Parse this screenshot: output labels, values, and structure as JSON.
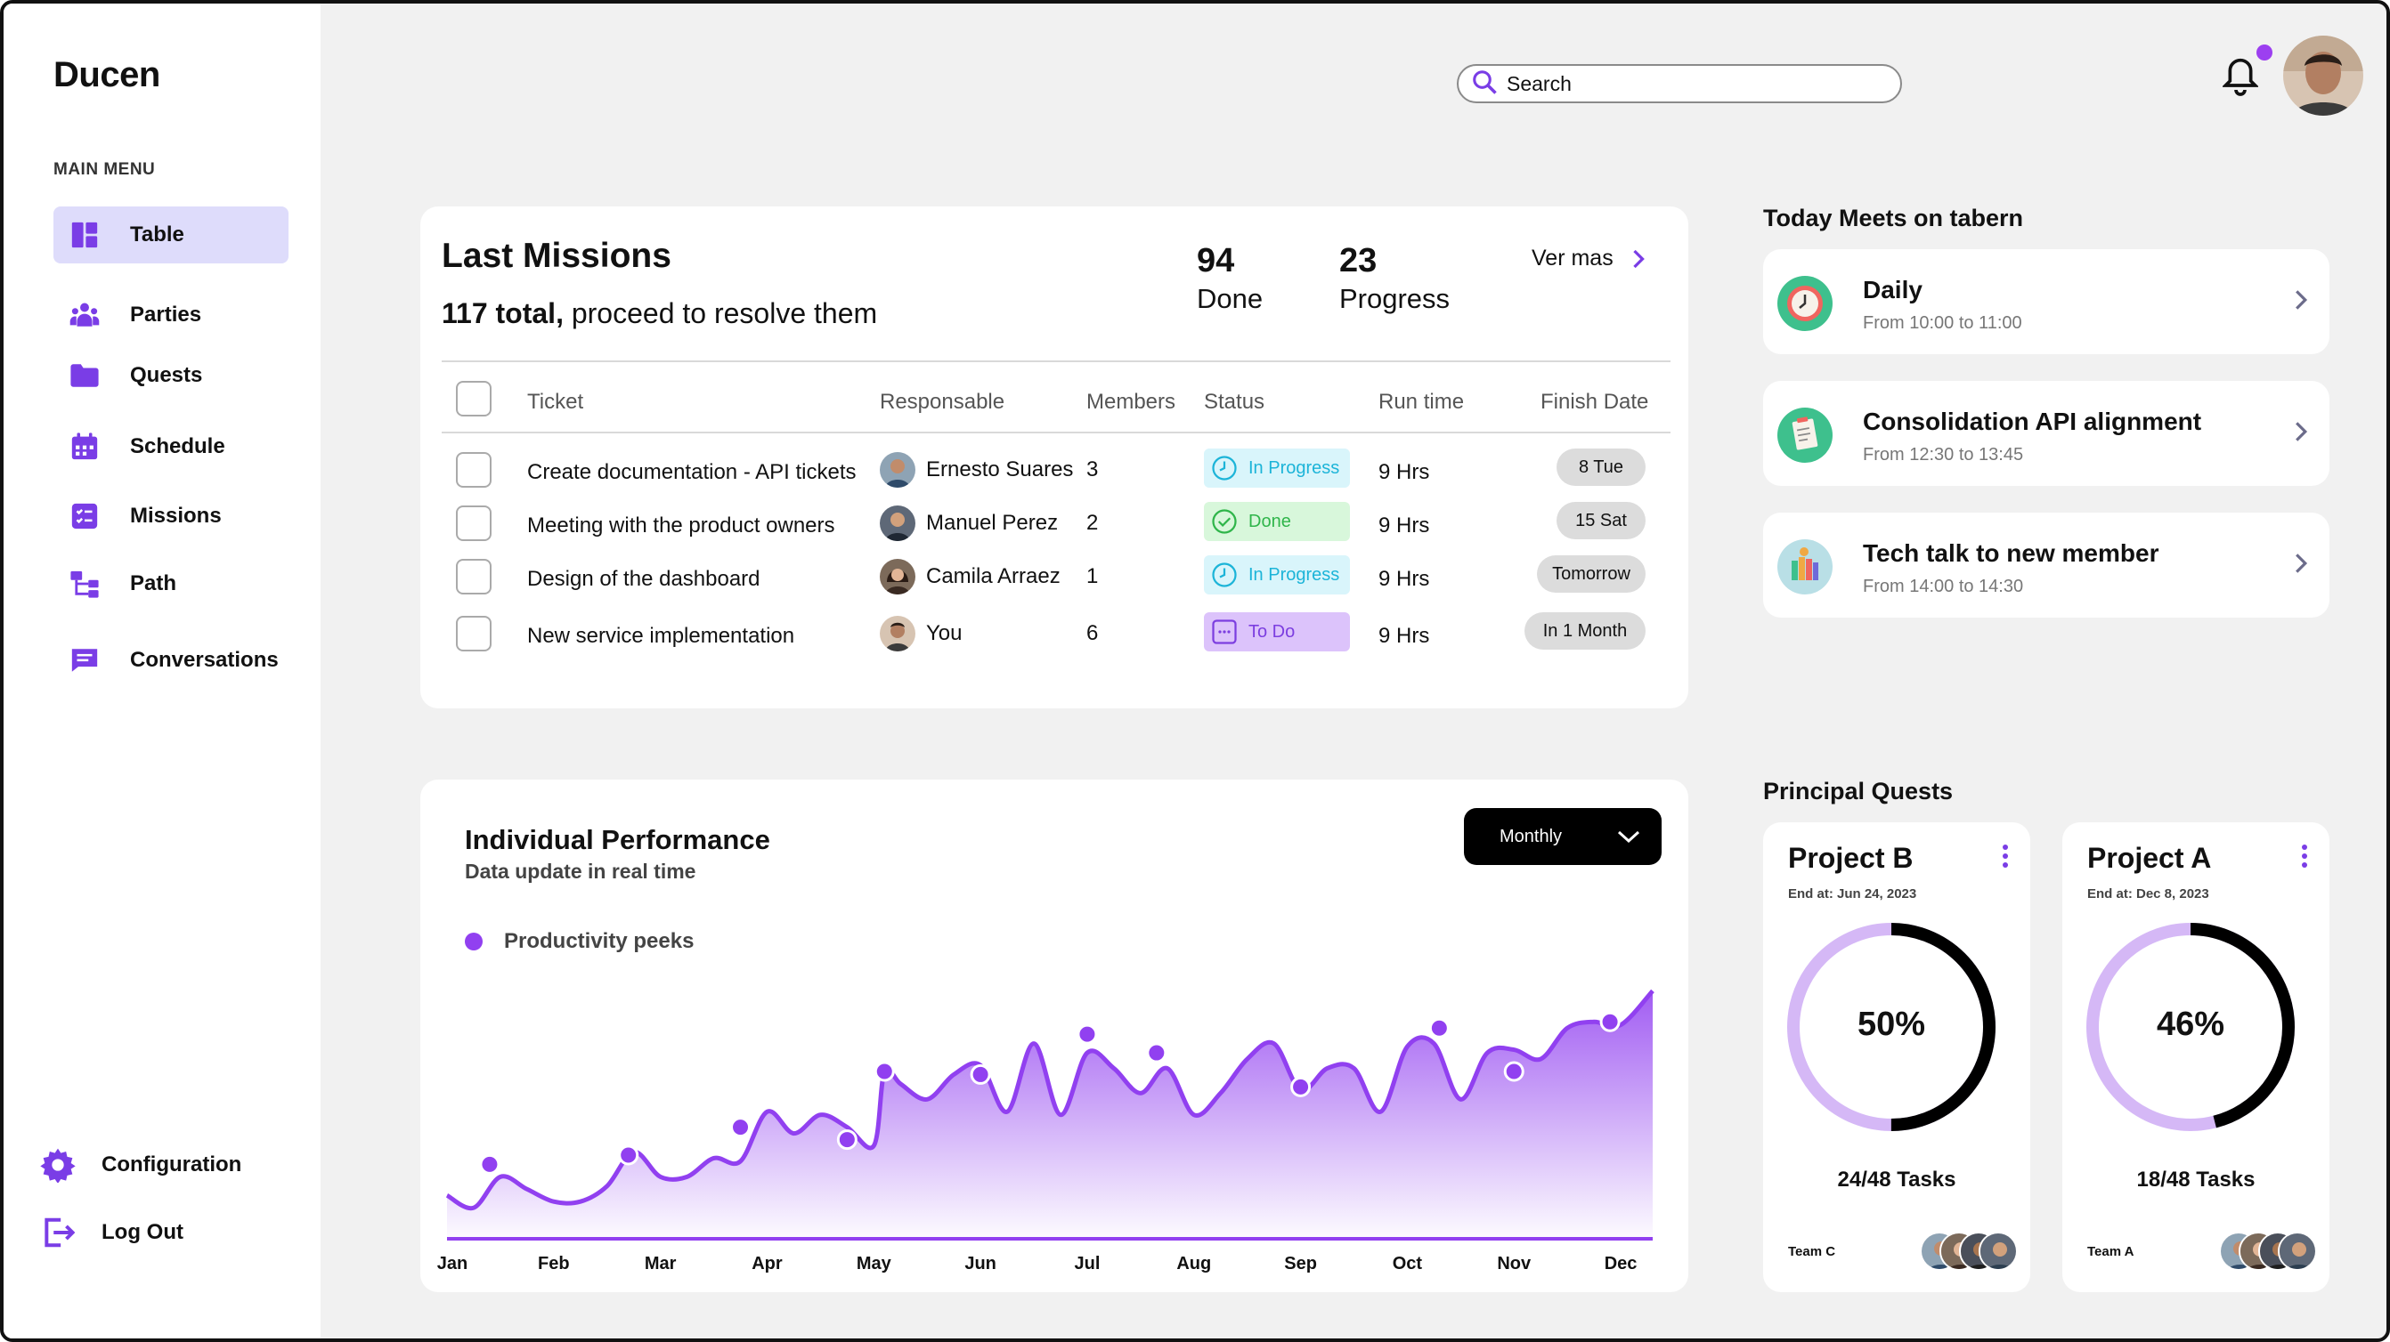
{
  "app": {
    "logo": "Ducen"
  },
  "sidebar": {
    "menu_heading": "MAIN MENU",
    "items": [
      {
        "label": "Table",
        "icon": "dashboard-icon",
        "active": true
      },
      {
        "label": "Parties",
        "icon": "users-icon"
      },
      {
        "label": "Quests",
        "icon": "folder-icon"
      },
      {
        "label": "Schedule",
        "icon": "calendar-icon"
      },
      {
        "label": "Missions",
        "icon": "checklist-icon"
      },
      {
        "label": "Path",
        "icon": "flow-icon"
      },
      {
        "label": "Conversations",
        "icon": "chat-icon"
      }
    ],
    "bottom": [
      {
        "label": "Configuration",
        "icon": "gear-icon"
      },
      {
        "label": "Log Out",
        "icon": "logout-icon"
      }
    ]
  },
  "topbar": {
    "search_placeholder": "Search"
  },
  "missions": {
    "title": "Last Missions",
    "total_bold": "117 total,",
    "total_rest": " proceed to resolve them",
    "done_count": "94",
    "done_label": "Done",
    "progress_count": "23",
    "progress_label": "Progress",
    "ver_mas": "Ver mas",
    "columns": [
      "Ticket",
      "Responsable",
      "Members",
      "Status",
      "Run time",
      "Finish Date"
    ],
    "rows": [
      {
        "ticket": "Create documentation - API tickets",
        "responsable": "Ernesto Suares",
        "members": "3",
        "status": "In Progress",
        "status_type": "progress",
        "run_time": "9 Hrs",
        "finish": "8 Tue"
      },
      {
        "ticket": "Meeting with the product owners",
        "responsable": "Manuel Perez",
        "members": "2",
        "status": "Done",
        "status_type": "done",
        "run_time": "9 Hrs",
        "finish": "15 Sat"
      },
      {
        "ticket": "Design of the dashboard",
        "responsable": "Camila Arraez",
        "members": "1",
        "status": "In Progress",
        "status_type": "progress",
        "run_time": "9 Hrs",
        "finish": "Tomorrow"
      },
      {
        "ticket": "New service implementation",
        "responsable": "You",
        "members": "6",
        "status": "To Do",
        "status_type": "todo",
        "run_time": "9 Hrs",
        "finish": "In 1 Month"
      }
    ]
  },
  "performance": {
    "title": "Individual Performance",
    "subtitle": "Data update in real time",
    "period": "Monthly",
    "legend": "Productivity peeks"
  },
  "chart_data": {
    "type": "area",
    "series": [
      {
        "name": "Productivity peeks"
      }
    ],
    "categories": [
      "Jan",
      "Feb",
      "Mar",
      "Apr",
      "May",
      "Jun",
      "Jul",
      "Aug",
      "Sep",
      "Oct",
      "Nov",
      "Dec"
    ],
    "x": [
      0,
      0.25,
      0.5,
      0.75,
      1,
      1.25,
      1.5,
      1.75,
      2,
      2.25,
      2.5,
      2.75,
      3,
      3.25,
      3.5,
      3.75,
      4,
      4.1,
      4.25,
      4.5,
      4.75,
      5,
      5.25,
      5.5,
      5.75,
      6,
      6.25,
      6.5,
      6.75,
      7,
      7.25,
      7.5,
      7.75,
      8,
      8.25,
      8.5,
      8.75,
      9,
      9.25,
      9.5,
      9.75,
      10,
      10.25,
      10.5,
      10.75,
      11,
      11.3
    ],
    "values": [
      14,
      10,
      20,
      16,
      12,
      12,
      17,
      28,
      20,
      20,
      26,
      25,
      41,
      34,
      40,
      36,
      30,
      54,
      50,
      45,
      53,
      56,
      41,
      63,
      40,
      60,
      55,
      47,
      55,
      40,
      47,
      58,
      63,
      48,
      55,
      55,
      41,
      62,
      63,
      45,
      60,
      61,
      58,
      68,
      70,
      69,
      80
    ],
    "markers": [
      {
        "x": 0.4,
        "y": 24
      },
      {
        "x": 1.7,
        "y": 27
      },
      {
        "x": 2.75,
        "y": 36
      },
      {
        "x": 3.75,
        "y": 32
      },
      {
        "x": 4.1,
        "y": 54
      },
      {
        "x": 5.0,
        "y": 53
      },
      {
        "x": 6.0,
        "y": 66
      },
      {
        "x": 6.65,
        "y": 60
      },
      {
        "x": 8.0,
        "y": 49
      },
      {
        "x": 9.3,
        "y": 68
      },
      {
        "x": 10.0,
        "y": 54
      },
      {
        "x": 10.9,
        "y": 70
      }
    ],
    "ylim": [
      0,
      85
    ],
    "grid": false,
    "accent": "#9140f0"
  },
  "meets": {
    "title": "Today Meets on tabern",
    "items": [
      {
        "title": "Daily",
        "time": "From 10:00 to 11:00",
        "icon": "clock-icon",
        "color": "#3ec08d"
      },
      {
        "title": "Consolidation API alignment",
        "time": "From 12:30 to 13:45",
        "icon": "notes-icon",
        "color": "#3ec08d"
      },
      {
        "title": "Tech talk to new member",
        "time": "From 14:00 to 14:30",
        "icon": "books-icon",
        "color": "#b9dfe6"
      }
    ]
  },
  "quests": {
    "title": "Principal Quests",
    "items": [
      {
        "name": "Project B",
        "end": "End at: Jun 24, 2023",
        "percent": "50%",
        "fraction": 0.5,
        "tasks": "24/48 Tasks",
        "team": "Team C"
      },
      {
        "name": "Project A",
        "end": "End at: Dec 8, 2023",
        "percent": "46%",
        "fraction": 0.46,
        "tasks": "18/48 Tasks",
        "team": "Team A"
      }
    ]
  },
  "colors": {
    "accent": "#9140f0",
    "active_nav": "#dedcfb",
    "ring_track": "#d5b8f6"
  }
}
